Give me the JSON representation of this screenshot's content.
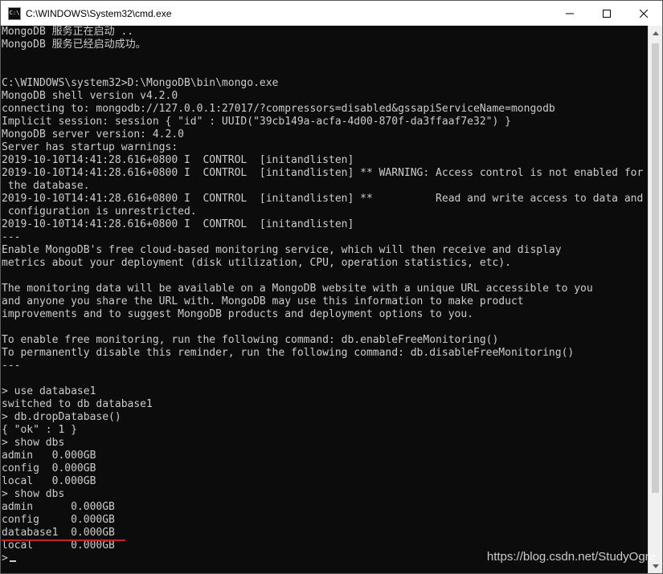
{
  "window": {
    "title": "C:\\WINDOWS\\System32\\cmd.exe",
    "icon_label": "C:\\"
  },
  "console": {
    "lines": [
      "MongoDB 服务正在启动 ..",
      "MongoDB 服务已经启动成功。",
      "",
      "",
      "C:\\WINDOWS\\system32>D:\\MongoDB\\bin\\mongo.exe",
      "MongoDB shell version v4.2.0",
      "connecting to: mongodb://127.0.0.1:27017/?compressors=disabled&gssapiServiceName=mongodb",
      "Implicit session: session { \"id\" : UUID(\"39cb149a-acfa-4d00-870f-da3ffaaf7e32\") }",
      "MongoDB server version: 4.2.0",
      "Server has startup warnings:",
      "2019-10-10T14:41:28.616+0800 I  CONTROL  [initandlisten]",
      "2019-10-10T14:41:28.616+0800 I  CONTROL  [initandlisten] ** WARNING: Access control is not enabled for",
      " the database.",
      "2019-10-10T14:41:28.616+0800 I  CONTROL  [initandlisten] **          Read and write access to data and",
      " configuration is unrestricted.",
      "2019-10-10T14:41:28.616+0800 I  CONTROL  [initandlisten]",
      "---",
      "Enable MongoDB's free cloud-based monitoring service, which will then receive and display",
      "metrics about your deployment (disk utilization, CPU, operation statistics, etc).",
      "",
      "The monitoring data will be available on a MongoDB website with a unique URL accessible to you",
      "and anyone you share the URL with. MongoDB may use this information to make product",
      "improvements and to suggest MongoDB products and deployment options to you.",
      "",
      "To enable free monitoring, run the following command: db.enableFreeMonitoring()",
      "To permanently disable this reminder, run the following command: db.disableFreeMonitoring()",
      "---",
      "",
      "> use database1",
      "switched to db database1",
      "> db.dropDatabase()",
      "{ \"ok\" : 1 }",
      "> show dbs",
      "admin   0.000GB",
      "config  0.000GB",
      "local   0.000GB",
      "> show dbs",
      "admin      0.000GB",
      "config     0.000GB",
      "database1  0.000GB",
      "local      0.000GB"
    ],
    "prompt": ">"
  },
  "watermark": "https://blog.csdn.net/StudyOgre",
  "colors": {
    "console_bg": "#0c0c0c",
    "console_fg": "#cccccc",
    "annotation": "#e8141b"
  }
}
